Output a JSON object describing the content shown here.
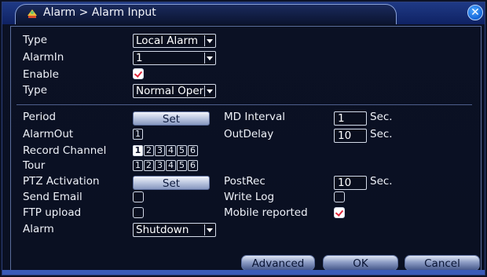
{
  "window": {
    "breadcrumb": "Alarm > Alarm Input",
    "close_glyph": "✕"
  },
  "form": {
    "type_label": "Type",
    "type_value": "Local Alarm",
    "alarmin_label": "AlarmIn",
    "alarmin_value": "1",
    "enable_label": "Enable",
    "enable_checked": true,
    "type2_label": "Type",
    "type2_value": "Normal Open",
    "period_label": "Period",
    "period_button": "Set",
    "md_interval_label": "MD Interval",
    "md_interval_value": "1",
    "md_interval_unit": "Sec.",
    "alarmout_label": "AlarmOut",
    "alarmout_channels": [
      "1"
    ],
    "outdelay_label": "OutDelay",
    "outdelay_value": "10",
    "outdelay_unit": "Sec.",
    "record_channel_label": "Record Channel",
    "record_channels": [
      "1",
      "2",
      "3",
      "4",
      "5",
      "6"
    ],
    "tour_label": "Tour",
    "tour_channels": [
      "1",
      "2",
      "3",
      "4",
      "5",
      "6"
    ],
    "ptz_label": "PTZ Activation",
    "ptz_button": "Set",
    "postrec_label": "PostRec",
    "postrec_value": "10",
    "postrec_unit": "Sec.",
    "send_email_label": "Send Email",
    "send_email_checked": false,
    "write_log_label": "Write Log",
    "write_log_checked": false,
    "ftp_label": "FTP upload",
    "ftp_checked": false,
    "mobile_label": "Mobile reported",
    "mobile_checked": true,
    "alarm_label": "Alarm",
    "alarm_value": "Shutdown"
  },
  "footer": {
    "advanced": "Advanced",
    "ok": "OK",
    "cancel": "Cancel"
  },
  "colors": {
    "titlebar": "#1f3a86",
    "background": "#0b1124",
    "check_mark": "#e0283c"
  }
}
